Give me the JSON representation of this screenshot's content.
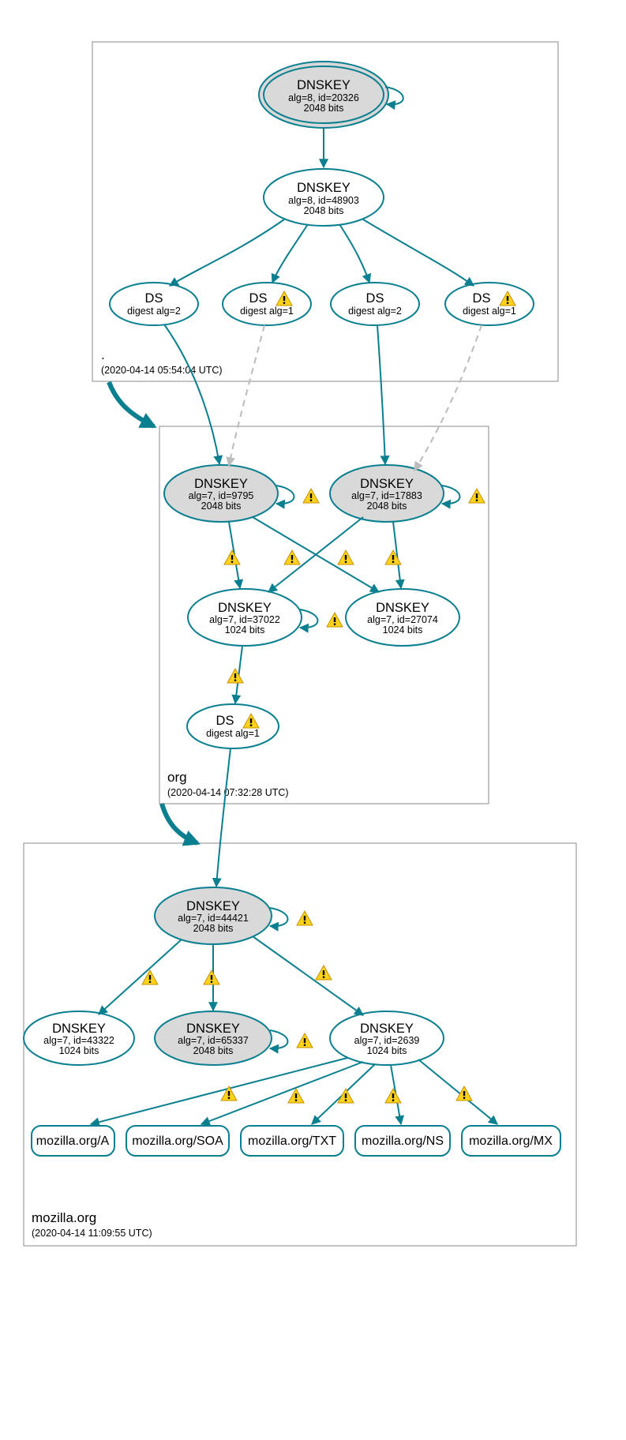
{
  "colors": {
    "teal": "#0a7f8f",
    "gray_fill": "#d9d9d9",
    "border": "#888"
  },
  "warning_icon": "warning-icon",
  "zones": {
    "root": {
      "label": ".",
      "timestamp": "(2020-04-14 05:54:04 UTC)"
    },
    "org": {
      "label": "org",
      "timestamp": "(2020-04-14 07:32:28 UTC)"
    },
    "mozilla": {
      "label": "mozilla.org",
      "timestamp": "(2020-04-14 11:09:55 UTC)"
    }
  },
  "nodes": {
    "root_ksk": {
      "title": "DNSKEY",
      "line2": "alg=8, id=20326",
      "line3": "2048 bits"
    },
    "root_zsk": {
      "title": "DNSKEY",
      "line2": "alg=8, id=48903",
      "line3": "2048 bits"
    },
    "root_ds1": {
      "title": "DS",
      "line2": "digest alg=2",
      "warn": false
    },
    "root_ds2": {
      "title": "DS",
      "line2": "digest alg=1",
      "warn": true
    },
    "root_ds3": {
      "title": "DS",
      "line2": "digest alg=2",
      "warn": false
    },
    "root_ds4": {
      "title": "DS",
      "line2": "digest alg=1",
      "warn": true
    },
    "org_ksk1": {
      "title": "DNSKEY",
      "line2": "alg=7, id=9795",
      "line3": "2048 bits"
    },
    "org_ksk2": {
      "title": "DNSKEY",
      "line2": "alg=7, id=17883",
      "line3": "2048 bits"
    },
    "org_zsk1": {
      "title": "DNSKEY",
      "line2": "alg=7, id=37022",
      "line3": "1024 bits"
    },
    "org_zsk2": {
      "title": "DNSKEY",
      "line2": "alg=7, id=27074",
      "line3": "1024 bits"
    },
    "org_ds": {
      "title": "DS",
      "line2": "digest alg=1",
      "warn": true
    },
    "moz_ksk": {
      "title": "DNSKEY",
      "line2": "alg=7, id=44421",
      "line3": "2048 bits"
    },
    "moz_k2": {
      "title": "DNSKEY",
      "line2": "alg=7, id=43322",
      "line3": "1024 bits"
    },
    "moz_k3": {
      "title": "DNSKEY",
      "line2": "alg=7, id=65337",
      "line3": "2048 bits"
    },
    "moz_zsk": {
      "title": "DNSKEY",
      "line2": "alg=7, id=2639",
      "line3": "1024 bits"
    }
  },
  "rrsets": {
    "a": "mozilla.org/A",
    "soa": "mozilla.org/SOA",
    "txt": "mozilla.org/TXT",
    "ns": "mozilla.org/NS",
    "mx": "mozilla.org/MX"
  }
}
